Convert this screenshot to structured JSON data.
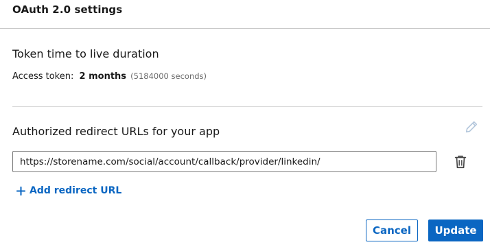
{
  "header": {
    "title": "OAuth 2.0 settings"
  },
  "token_section": {
    "title": "Token time to live duration",
    "access_label": "Access token:",
    "access_value": "2 months",
    "access_seconds": "(5184000 seconds)"
  },
  "redirect_section": {
    "title": "Authorized redirect URLs for your app",
    "urls": [
      "https://storename.com/social/account/callback/provider/linkedin/"
    ],
    "add_label": "Add redirect URL"
  },
  "footer": {
    "cancel_label": "Cancel",
    "update_label": "Update"
  },
  "colors": {
    "accent": "#0a66c2",
    "icon_muted": "#b4c7dc",
    "divider": "#d6d6d6"
  },
  "icons": {
    "edit": "pencil-icon",
    "delete": "trash-icon",
    "add": "plus-icon"
  }
}
